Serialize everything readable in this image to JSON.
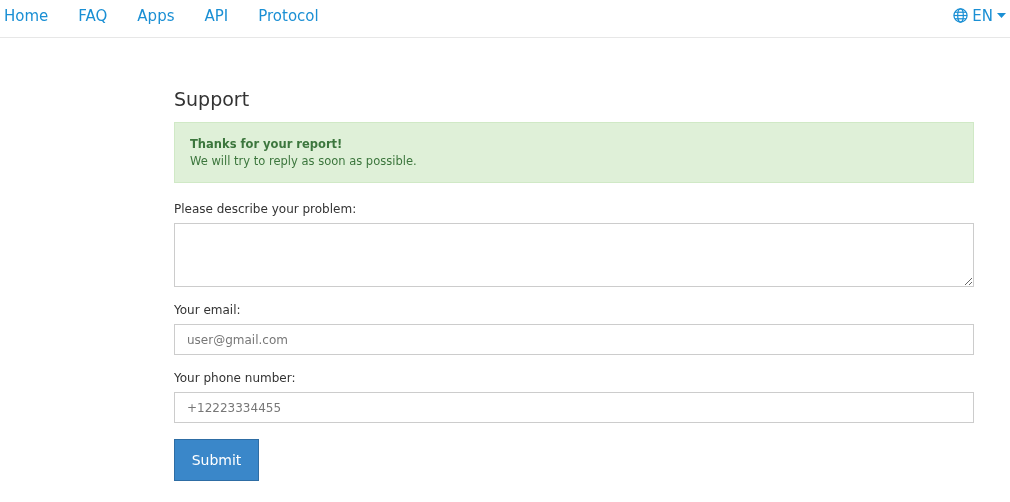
{
  "nav": {
    "links": [
      {
        "label": "Home"
      },
      {
        "label": "FAQ"
      },
      {
        "label": "Apps"
      },
      {
        "label": "API"
      },
      {
        "label": "Protocol"
      }
    ],
    "language": "EN"
  },
  "page": {
    "title": "Support",
    "alert": {
      "title": "Thanks for your report!",
      "message": "We will try to reply as soon as possible."
    },
    "fields": [
      {
        "kind": "textarea",
        "label": "Please describe your problem:"
      },
      {
        "kind": "input",
        "label": "Your email:",
        "placeholder": "user@gmail.com"
      },
      {
        "kind": "input",
        "label": "Your phone number:",
        "placeholder": "+12223334455"
      }
    ],
    "submit": "Submit"
  }
}
